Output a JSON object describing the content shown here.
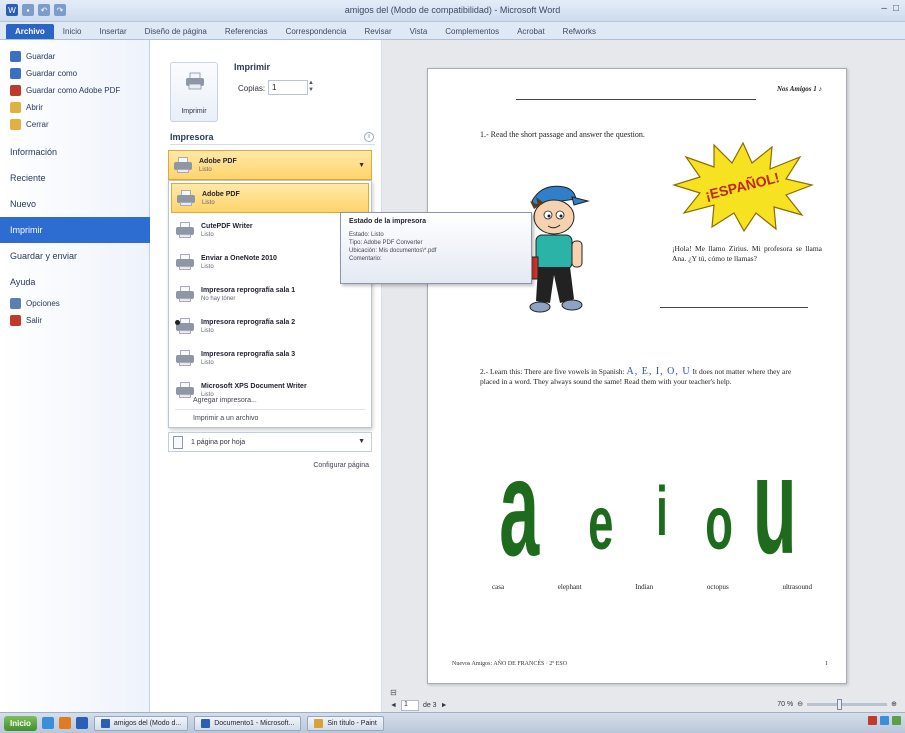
{
  "window": {
    "title": "amigos del (Modo de compatibilidad) - Microsoft Word"
  },
  "ribbon": {
    "tabs": [
      "Archivo",
      "Inicio",
      "Insertar",
      "Diseño de página",
      "Referencias",
      "Correspondencia",
      "Revisar",
      "Vista",
      "Complementos",
      "Acrobat",
      "Refworks"
    ]
  },
  "backstage": {
    "commands": [
      {
        "label": "Guardar",
        "color": "#3a6fc4"
      },
      {
        "label": "Guardar como",
        "color": "#3a6fc4"
      },
      {
        "label": "Guardar como Adobe PDF",
        "color": "#c0392b"
      },
      {
        "label": "Abrir",
        "color": "#e0b040"
      },
      {
        "label": "Cerrar",
        "color": "#e0b040"
      }
    ],
    "sections": [
      "Información",
      "Reciente",
      "Nuevo",
      "Imprimir",
      "Guardar y enviar",
      "Ayuda"
    ],
    "active_section": "Imprimir",
    "bottom_commands": [
      {
        "label": "Opciones",
        "color": "#5a7fb5"
      },
      {
        "label": "Salir",
        "color": "#c0392b"
      }
    ]
  },
  "print_panel": {
    "print_heading": "Imprimir",
    "print_button_label": "Imprimir",
    "copies_label": "Copias:",
    "copies_value": "1",
    "printer_heading": "Impresora",
    "selected_printer": {
      "name": "Adobe PDF",
      "status": "Listo"
    },
    "printers": [
      {
        "name": "Adobe PDF",
        "status": "Listo",
        "selected": true,
        "online": false
      },
      {
        "name": "CutePDF Writer",
        "status": "Listo",
        "selected": false,
        "online": false
      },
      {
        "name": "Enviar a OneNote 2010",
        "status": "Listo",
        "selected": false,
        "online": false
      },
      {
        "name": "Impresora reprografía sala 1",
        "status": "No hay tóner",
        "selected": false,
        "online": false
      },
      {
        "name": "Impresora reprografía sala 2",
        "status": "Listo",
        "selected": false,
        "online": true
      },
      {
        "name": "Impresora reprografía sala 3",
        "status": "Listo",
        "selected": false,
        "online": false
      },
      {
        "name": "Microsoft XPS Document Writer",
        "status": "Listo",
        "selected": false,
        "online": false
      }
    ],
    "add_printer": "Agregar impresora...",
    "print_to_file": "Imprimir a un archivo",
    "pages_per_sheet": "1 página por hoja",
    "page_setup": "Configurar página"
  },
  "tooltip": {
    "title": "Estado de la impresora",
    "lines": [
      "Estado: Listo",
      "Tipo: Adobe PDF Converter",
      "Ubicación: Mis documentos\\*.pdf",
      "Comentario:"
    ]
  },
  "document": {
    "header": "Nos Amigos 1 ♪",
    "exercise1": "1.- Read the short passage and answer the question.",
    "starburst": "¡ESPAÑOL!",
    "dialog": "¡Hola! Me llamo Zirius. Mi profesora se llama Ana. ¿Y tú, cómo te llamas?",
    "exercise2_intro": "2.- Learn this: There are five vowels in Spanish:",
    "exercise2_vowels": "A, E, I, O, U",
    "exercise2_rest": "It does not matter where they are placed in a word. They always sound the same! Read them with your teacher's help.",
    "big_vowels": [
      "a",
      "e",
      "i",
      "o",
      "u"
    ],
    "words": [
      "casa",
      "elephant",
      "Indian",
      "octopus",
      "ultrasound"
    ],
    "footer": "Nuevos Amigos: AÑO DE FRANCÉS · 2º ESO",
    "page_number": "1"
  },
  "preview_nav": {
    "current_page": "1",
    "of_text": "de 3",
    "zoom": "70 %"
  },
  "taskbar": {
    "start": "Inicio",
    "tasks": [
      "amigos del (Modo d...",
      "Documento1 - Microsoft...",
      "Sin título - Paint"
    ]
  },
  "colors": {
    "accent": "#2d6cd0",
    "highlight": "#ffd46a",
    "vowel_green": "#1e6b1e",
    "starburst_fill": "#f7e221"
  }
}
